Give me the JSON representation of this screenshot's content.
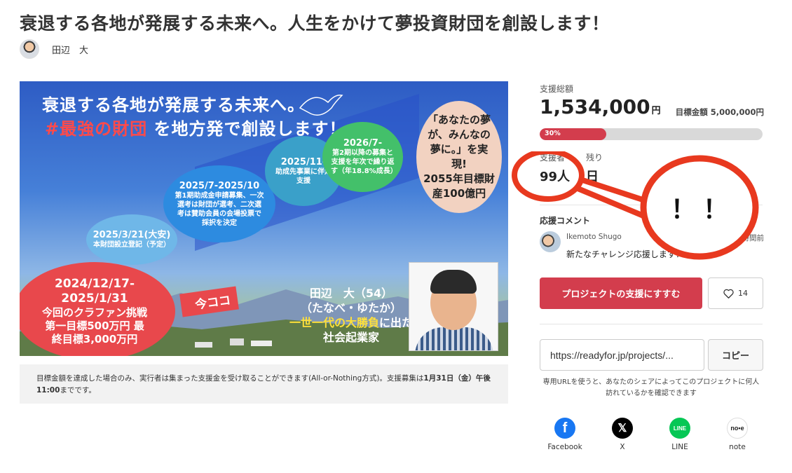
{
  "page": {
    "title": "衰退する各地が発展する未来へ。人生をかけて夢投資財団を創設します！",
    "owner_name": "田辺　大"
  },
  "hero": {
    "title_line1": "衰退する各地が発展する未来へ。",
    "title_line2_highlight": "#最強の財団",
    "title_line2_rest": " を地方発で創設します！",
    "bubbles": [
      {
        "date": "2025/3/21(大安)",
        "text": "本財団設立登記（予定）"
      },
      {
        "date": "2025/7-2025/10",
        "text": "第1期助成金申請募集、一次選考は財団が選考、二次選考は賛助会員の会場投票で採択を決定"
      },
      {
        "date": "2025/11-",
        "text": "助成先事業に伴走支援"
      },
      {
        "date": "2026/7-",
        "text": "第2期以降の募集と支援を年次で繰り返す（年18.8%成長）"
      }
    ],
    "goal_line1": "「あなたの夢が、みんなの夢に。」を実現!",
    "goal_line2": "2055年目標財産100億円",
    "current_date": "2024/12/17-2025/1/31",
    "current_text": "今回のクラファン挑戦 第一目標500万円 最終目標3,000万円",
    "here_tag": "今ココ",
    "person_name": "田辺　大（54）",
    "person_kana": "（たなべ・ゆたか）",
    "person_tagline": "一世一代の大勝負",
    "person_tagline_rest": "に出た",
    "person_role": "社会起業家"
  },
  "notice": {
    "text": "目標金額を達成した場合のみ、実行者は集まった支援金を受け取ることができます(All-or-Nothing方式)。支援募集は",
    "deadline": "1月31日（金）午後11:00",
    "suffix": "までです。"
  },
  "stats": {
    "total_label": "支援総額",
    "total_amount": "1,534,000",
    "currency": "円",
    "target_label": "目標金額 5,000,000円",
    "progress_text": "30%",
    "progress_fraction": 0.3,
    "backers_label": "支援者",
    "backers_value": "99人",
    "remaining_label": "残り",
    "remaining_value": "日"
  },
  "comments": {
    "label": "応援コメント",
    "items": [
      {
        "name": "Ikemoto Shugo",
        "time": "時間前",
        "body": "新たなチャレンジ応援します！"
      }
    ]
  },
  "actions": {
    "support_label": "プロジェクトの支援にすすむ",
    "favorite_count": "14",
    "share_url": "https://readyfor.jp/projects/...",
    "copy_label": "コピー",
    "url_help": "専用URLを使うと、あなたのシェアによってこのプロジェクトに何人訪れているかを確認できます"
  },
  "shares": [
    {
      "label": "Facebook",
      "icon": "facebook-icon",
      "color": "#1877f2"
    },
    {
      "label": "X",
      "icon": "x-icon",
      "color": "#000000"
    },
    {
      "label": "LINE",
      "icon": "line-icon",
      "color": "#06c755"
    },
    {
      "label": "note",
      "icon": "note-icon",
      "color": "#ffffff"
    }
  ],
  "annotation": {
    "text": "！！",
    "color": "#e8391f"
  },
  "colors": {
    "accent": "#d33d4d",
    "progress_track": "#d9d9d9"
  }
}
